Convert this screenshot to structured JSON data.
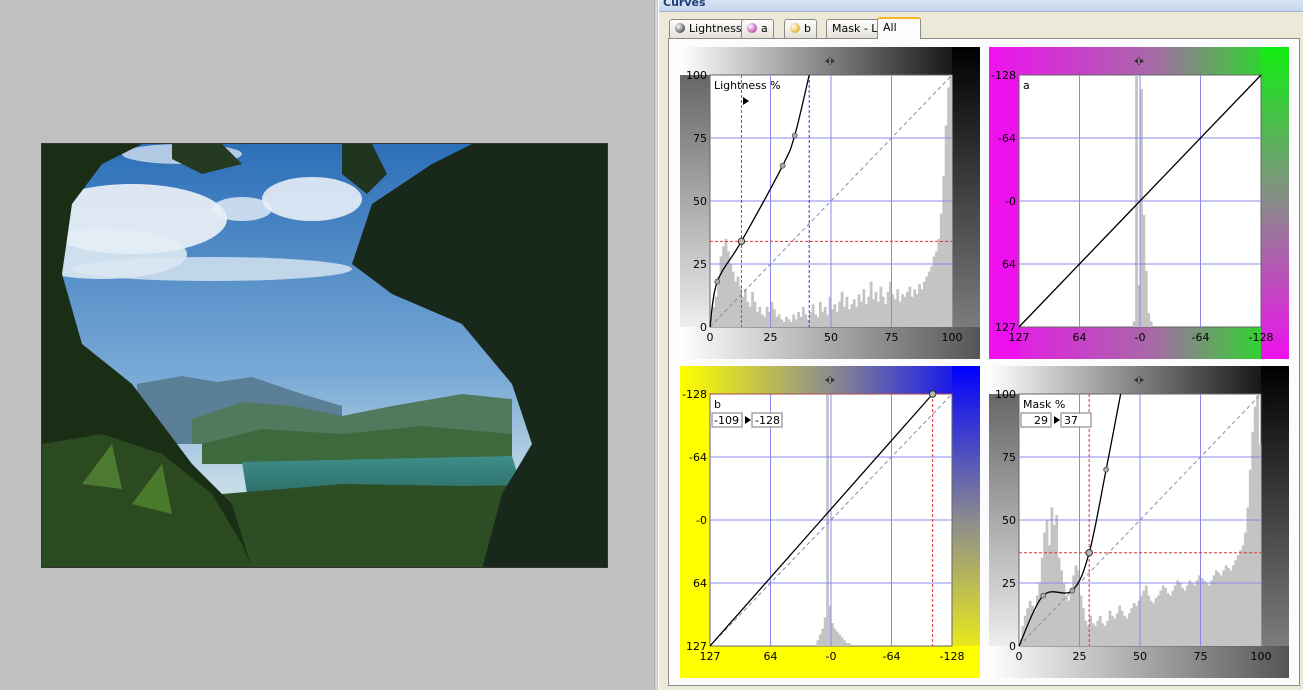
{
  "panel": {
    "title": "Curves"
  },
  "tabs": [
    {
      "label": "Lightness",
      "icon": "lightness-icon",
      "dot": "#5a5a5a",
      "active": false
    },
    {
      "label": "a",
      "icon": "a-channel-icon",
      "dot": "#c64fb3",
      "active": false
    },
    {
      "label": "b",
      "icon": "b-channel-icon",
      "dot": "#e0b830",
      "active": false
    },
    {
      "label": "Mask - L",
      "icon": "",
      "dot": "",
      "active": false
    },
    {
      "label": "All",
      "icon": "",
      "dot": "",
      "active": true
    }
  ],
  "colors": {
    "grid": "#8888ee",
    "histogram": "#c4c4c4",
    "curve": "#000000",
    "guide_red": "#dd3333",
    "guide_blue": "#3333cc",
    "tab_highlight": "#f8b52b"
  },
  "chart_data": [
    {
      "type": "line",
      "id": "lightness",
      "channel_label": "Lightness %",
      "x_ticks": [
        "0",
        "25",
        "50",
        "75",
        "100"
      ],
      "y_ticks": [
        "100",
        "75",
        "50",
        "25",
        "0"
      ],
      "background": "gray-gradient",
      "xlim": [
        0,
        100
      ],
      "ylim": [
        0,
        100
      ],
      "curve_points": [
        [
          0,
          0
        ],
        [
          3,
          18
        ],
        [
          13,
          34
        ],
        [
          30,
          64
        ],
        [
          35,
          76
        ],
        [
          41,
          100
        ]
      ],
      "marker": [
        13,
        34
      ],
      "blue_guide_x": 41,
      "histogram": [
        5,
        8,
        12,
        20,
        28,
        32,
        35,
        30,
        25,
        22,
        18,
        20,
        16,
        12,
        15,
        10,
        8,
        14,
        10,
        6,
        8,
        5,
        4,
        8,
        6,
        10,
        7,
        4,
        5,
        3,
        2,
        4,
        3,
        2,
        5,
        3,
        6,
        4,
        8,
        5,
        3,
        6,
        9,
        5,
        4,
        10,
        6,
        8,
        5,
        12,
        7,
        9,
        6,
        10,
        14,
        8,
        12,
        7,
        9,
        11,
        8,
        13,
        10,
        15,
        9,
        12,
        18,
        11,
        14,
        10,
        16,
        12,
        9,
        14,
        18,
        13,
        11,
        15,
        10,
        13,
        12,
        14,
        16,
        12,
        15,
        13,
        17,
        15,
        18,
        20,
        22,
        24,
        28,
        30,
        35,
        45,
        60,
        80,
        95,
        100
      ]
    },
    {
      "type": "line",
      "id": "a",
      "channel_label": "a",
      "x_ticks": [
        "127",
        "64",
        "-0",
        "-64",
        "-128"
      ],
      "y_ticks": [
        "-128",
        "-64",
        "-0",
        "64",
        "127"
      ],
      "background": "magenta-green",
      "xlim": [
        0,
        100
      ],
      "ylim": [
        0,
        100
      ],
      "curve_points": [
        [
          0,
          0
        ],
        [
          100,
          100
        ]
      ],
      "histogram": [
        0,
        0,
        0,
        0,
        0,
        0,
        0,
        0,
        0,
        0,
        0,
        0,
        0,
        0,
        0,
        0,
        0,
        0,
        0,
        0,
        0,
        0,
        0,
        0,
        0,
        0,
        0,
        0,
        0,
        0,
        0,
        0,
        0,
        0,
        0,
        0,
        0,
        0,
        0,
        0,
        0,
        0,
        0,
        0,
        0,
        0,
        0,
        2,
        90,
        15,
        85,
        40,
        20,
        5,
        2,
        0,
        0,
        0,
        0,
        0,
        0,
        0,
        0,
        0,
        0,
        0,
        0,
        0,
        0,
        0,
        0,
        0,
        0,
        0,
        0,
        0,
        0,
        0,
        0,
        0,
        0,
        0,
        0,
        0,
        0,
        0,
        0,
        0,
        0,
        0,
        0,
        0,
        0,
        0,
        0,
        0,
        0,
        0,
        0,
        0
      ]
    },
    {
      "type": "line",
      "id": "b",
      "channel_label": "b",
      "input_value": "-109",
      "output_value": "-128",
      "x_ticks": [
        "127",
        "64",
        "-0",
        "-64",
        "-128"
      ],
      "y_ticks": [
        "-128",
        "-64",
        "-0",
        "64",
        "127"
      ],
      "background": "yellow-blue",
      "xlim": [
        0,
        100
      ],
      "ylim": [
        0,
        100
      ],
      "curve_points": [
        [
          0,
          0
        ],
        [
          92,
          100
        ]
      ],
      "marker": [
        92,
        100
      ],
      "histogram": [
        0,
        0,
        0,
        0,
        0,
        0,
        0,
        0,
        0,
        0,
        0,
        0,
        0,
        0,
        0,
        0,
        0,
        0,
        0,
        0,
        0,
        0,
        0,
        0,
        0,
        0,
        0,
        0,
        0,
        0,
        0,
        0,
        0,
        0,
        0,
        0,
        0,
        0,
        0,
        0,
        0,
        0,
        0,
        0,
        2,
        4,
        6,
        10,
        88,
        14,
        8,
        6,
        5,
        4,
        3,
        2,
        1,
        1,
        0,
        0,
        0,
        0,
        0,
        0,
        0,
        0,
        0,
        0,
        0,
        0,
        0,
        0,
        0,
        0,
        0,
        0,
        0,
        0,
        0,
        0,
        0,
        0,
        0,
        0,
        0,
        0,
        0,
        0,
        0,
        0,
        0,
        0,
        0,
        0,
        0,
        0,
        0,
        0,
        0,
        0
      ]
    },
    {
      "type": "line",
      "id": "mask",
      "channel_label": "Mask %",
      "input_value": "29",
      "output_value": "37",
      "x_ticks": [
        "0",
        "25",
        "50",
        "75",
        "100"
      ],
      "y_ticks": [
        "100",
        "75",
        "50",
        "25",
        "0"
      ],
      "background": "gray-gradient",
      "xlim": [
        0,
        100
      ],
      "ylim": [
        0,
        100
      ],
      "curve_points": [
        [
          0,
          0
        ],
        [
          10,
          20
        ],
        [
          22,
          22
        ],
        [
          29,
          37
        ],
        [
          36,
          70
        ],
        [
          42,
          100
        ]
      ],
      "marker": [
        29,
        37
      ],
      "histogram": [
        3,
        8,
        12,
        15,
        18,
        16,
        14,
        20,
        25,
        35,
        45,
        50,
        40,
        55,
        48,
        52,
        35,
        30,
        25,
        20,
        18,
        22,
        28,
        32,
        30,
        20,
        15,
        10,
        8,
        12,
        9,
        8,
        10,
        12,
        9,
        8,
        10,
        14,
        12,
        11,
        13,
        16,
        14,
        12,
        11,
        13,
        15,
        17,
        16,
        18,
        20,
        22,
        24,
        20,
        18,
        17,
        19,
        20,
        22,
        24,
        23,
        21,
        20,
        22,
        24,
        26,
        25,
        23,
        22,
        24,
        26,
        25,
        24,
        26,
        28,
        27,
        26,
        25,
        24,
        26,
        28,
        30,
        29,
        28,
        30,
        32,
        31,
        30,
        32,
        34,
        36,
        38,
        40,
        45,
        55,
        70,
        85,
        95,
        100,
        80
      ]
    }
  ]
}
